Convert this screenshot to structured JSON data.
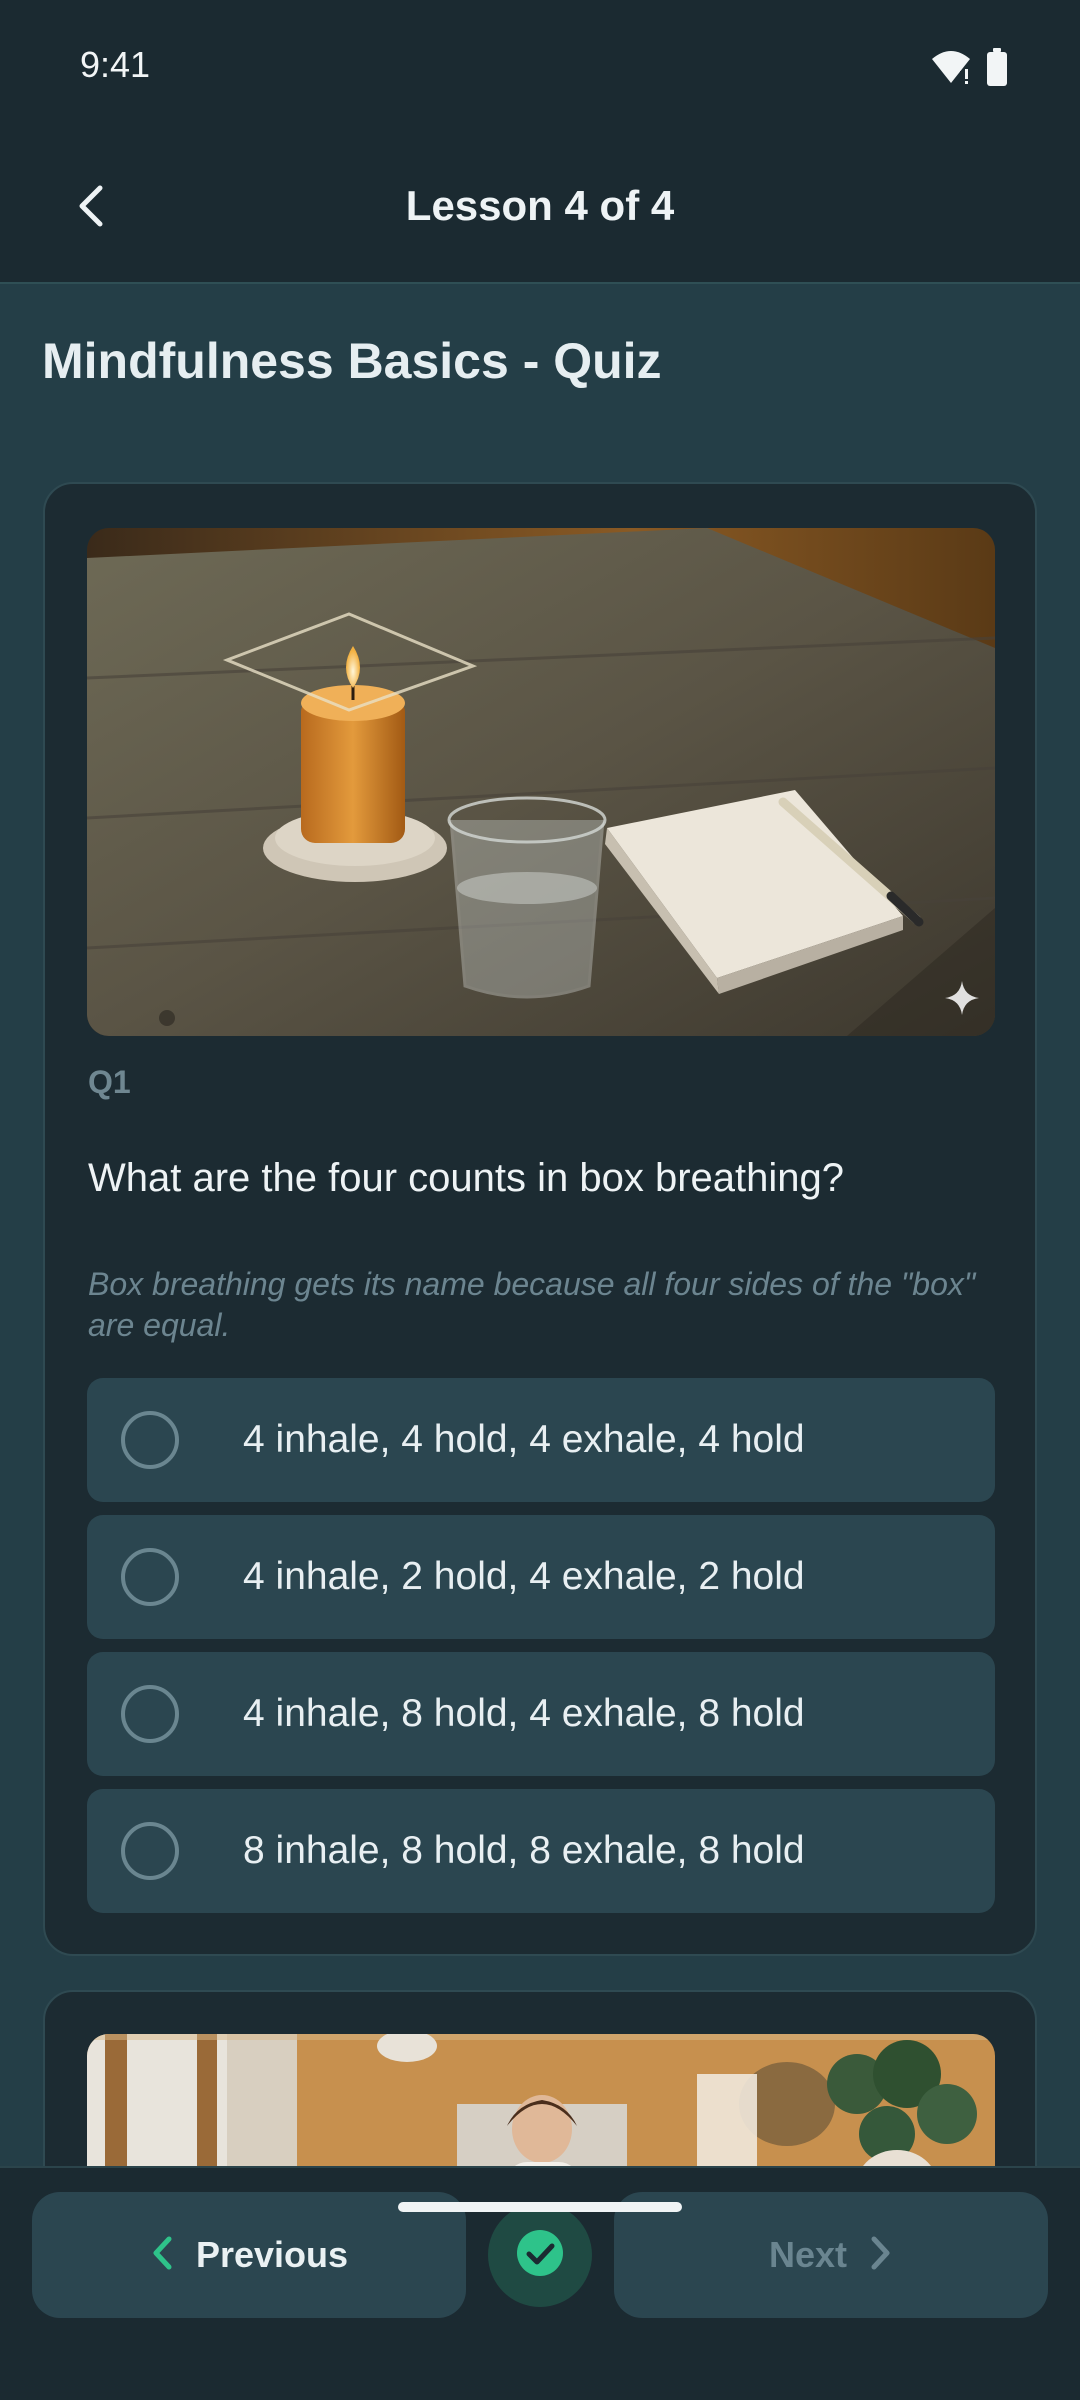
{
  "status_bar": {
    "time": "9:41",
    "icons": [
      "wifi-icon",
      "battery-icon"
    ]
  },
  "app_bar": {
    "title": "Lesson 4 of 4",
    "back_icon": "chevron-left-icon"
  },
  "page": {
    "title": "Mindfulness Basics - Quiz"
  },
  "question": {
    "number": "Q1",
    "text": "What are the four counts in box breathing?",
    "hint": "Box breathing gets its name because all four sides of the \"box\" are equal.",
    "image_icon": "sparkle-icon",
    "options": [
      {
        "label": "4 inhale, 4 hold, 4 exhale, 4 hold",
        "selected": false
      },
      {
        "label": "4 inhale, 2 hold, 4 exhale, 2 hold",
        "selected": false
      },
      {
        "label": "4 inhale, 8 hold, 4 exhale, 8 hold",
        "selected": false
      },
      {
        "label": "8 inhale, 8 hold, 8 exhale, 8 hold",
        "selected": false
      }
    ]
  },
  "bottom_nav": {
    "previous_label": "Previous",
    "next_label": "Next",
    "next_enabled": false,
    "done_icon": "check-circle-icon"
  },
  "colors": {
    "accent": "#2ec38a",
    "background": "#243e47",
    "surface": "#1c2b32",
    "option_bg": "#2b4650"
  }
}
